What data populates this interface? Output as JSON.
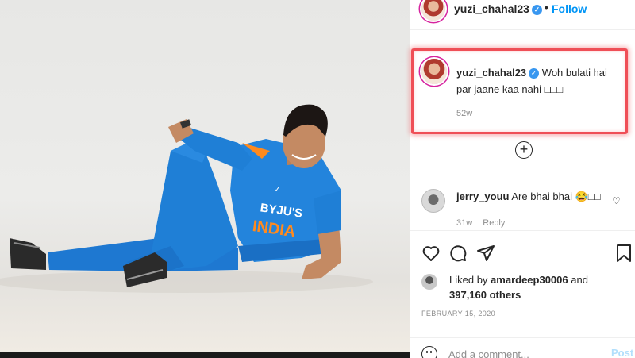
{
  "header": {
    "username": "yuzi_chahal23",
    "verified_icon": "verified-badge-icon",
    "separator": "•",
    "follow_label": "Follow"
  },
  "caption": {
    "username": "yuzi_chahal23",
    "text": "Woh bulati hai par jaane kaa nahi □□□",
    "time": "52w"
  },
  "load_more": {
    "icon": "plus-circle-icon",
    "label": "+"
  },
  "comment": {
    "username": "jerry_youu",
    "text": "Are bhai bhai 😂□□",
    "time": "31w",
    "reply_label": "Reply",
    "like_icon": "heart-outline-icon"
  },
  "actions": {
    "like_icon": "heart-icon",
    "comment_icon": "comment-icon",
    "share_icon": "share-icon",
    "save_icon": "bookmark-icon"
  },
  "likes": {
    "prefix": "Liked by ",
    "user": "amardeep30006",
    "and": " and ",
    "others": "397,160 others"
  },
  "date": "FEBRUARY 15, 2020",
  "add_comment": {
    "placeholder": "Add a comment...",
    "post_label": "Post"
  },
  "photo": {
    "jersey_sponsor": "BYJU'S",
    "jersey_text": "INDIA"
  },
  "colors": {
    "accent": "#0095f6",
    "highlight": "#ef4f57",
    "jersey_blue": "#1f7fd6"
  }
}
